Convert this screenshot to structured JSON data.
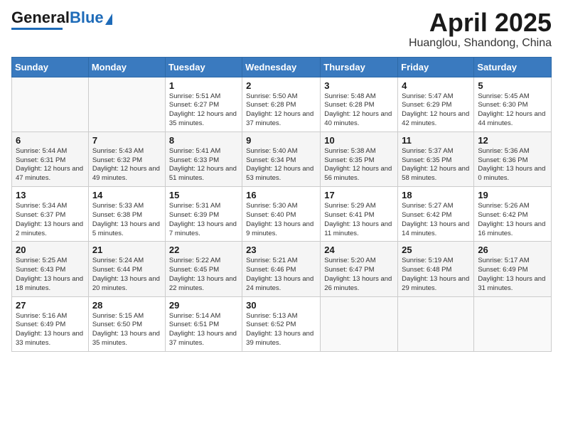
{
  "header": {
    "logo_general": "General",
    "logo_blue": "Blue",
    "title": "April 2025",
    "subtitle": "Huanglou, Shandong, China"
  },
  "weekdays": [
    "Sunday",
    "Monday",
    "Tuesday",
    "Wednesday",
    "Thursday",
    "Friday",
    "Saturday"
  ],
  "weeks": [
    [
      null,
      null,
      {
        "day": 1,
        "sunrise": "5:51 AM",
        "sunset": "6:27 PM",
        "daylight": "12 hours and 35 minutes."
      },
      {
        "day": 2,
        "sunrise": "5:50 AM",
        "sunset": "6:28 PM",
        "daylight": "12 hours and 37 minutes."
      },
      {
        "day": 3,
        "sunrise": "5:48 AM",
        "sunset": "6:28 PM",
        "daylight": "12 hours and 40 minutes."
      },
      {
        "day": 4,
        "sunrise": "5:47 AM",
        "sunset": "6:29 PM",
        "daylight": "12 hours and 42 minutes."
      },
      {
        "day": 5,
        "sunrise": "5:45 AM",
        "sunset": "6:30 PM",
        "daylight": "12 hours and 44 minutes."
      }
    ],
    [
      {
        "day": 6,
        "sunrise": "5:44 AM",
        "sunset": "6:31 PM",
        "daylight": "12 hours and 47 minutes."
      },
      {
        "day": 7,
        "sunrise": "5:43 AM",
        "sunset": "6:32 PM",
        "daylight": "12 hours and 49 minutes."
      },
      {
        "day": 8,
        "sunrise": "5:41 AM",
        "sunset": "6:33 PM",
        "daylight": "12 hours and 51 minutes."
      },
      {
        "day": 9,
        "sunrise": "5:40 AM",
        "sunset": "6:34 PM",
        "daylight": "12 hours and 53 minutes."
      },
      {
        "day": 10,
        "sunrise": "5:38 AM",
        "sunset": "6:35 PM",
        "daylight": "12 hours and 56 minutes."
      },
      {
        "day": 11,
        "sunrise": "5:37 AM",
        "sunset": "6:35 PM",
        "daylight": "12 hours and 58 minutes."
      },
      {
        "day": 12,
        "sunrise": "5:36 AM",
        "sunset": "6:36 PM",
        "daylight": "13 hours and 0 minutes."
      }
    ],
    [
      {
        "day": 13,
        "sunrise": "5:34 AM",
        "sunset": "6:37 PM",
        "daylight": "13 hours and 2 minutes."
      },
      {
        "day": 14,
        "sunrise": "5:33 AM",
        "sunset": "6:38 PM",
        "daylight": "13 hours and 5 minutes."
      },
      {
        "day": 15,
        "sunrise": "5:31 AM",
        "sunset": "6:39 PM",
        "daylight": "13 hours and 7 minutes."
      },
      {
        "day": 16,
        "sunrise": "5:30 AM",
        "sunset": "6:40 PM",
        "daylight": "13 hours and 9 minutes."
      },
      {
        "day": 17,
        "sunrise": "5:29 AM",
        "sunset": "6:41 PM",
        "daylight": "13 hours and 11 minutes."
      },
      {
        "day": 18,
        "sunrise": "5:27 AM",
        "sunset": "6:42 PM",
        "daylight": "13 hours and 14 minutes."
      },
      {
        "day": 19,
        "sunrise": "5:26 AM",
        "sunset": "6:42 PM",
        "daylight": "13 hours and 16 minutes."
      }
    ],
    [
      {
        "day": 20,
        "sunrise": "5:25 AM",
        "sunset": "6:43 PM",
        "daylight": "13 hours and 18 minutes."
      },
      {
        "day": 21,
        "sunrise": "5:24 AM",
        "sunset": "6:44 PM",
        "daylight": "13 hours and 20 minutes."
      },
      {
        "day": 22,
        "sunrise": "5:22 AM",
        "sunset": "6:45 PM",
        "daylight": "13 hours and 22 minutes."
      },
      {
        "day": 23,
        "sunrise": "5:21 AM",
        "sunset": "6:46 PM",
        "daylight": "13 hours and 24 minutes."
      },
      {
        "day": 24,
        "sunrise": "5:20 AM",
        "sunset": "6:47 PM",
        "daylight": "13 hours and 26 minutes."
      },
      {
        "day": 25,
        "sunrise": "5:19 AM",
        "sunset": "6:48 PM",
        "daylight": "13 hours and 29 minutes."
      },
      {
        "day": 26,
        "sunrise": "5:17 AM",
        "sunset": "6:49 PM",
        "daylight": "13 hours and 31 minutes."
      }
    ],
    [
      {
        "day": 27,
        "sunrise": "5:16 AM",
        "sunset": "6:49 PM",
        "daylight": "13 hours and 33 minutes."
      },
      {
        "day": 28,
        "sunrise": "5:15 AM",
        "sunset": "6:50 PM",
        "daylight": "13 hours and 35 minutes."
      },
      {
        "day": 29,
        "sunrise": "5:14 AM",
        "sunset": "6:51 PM",
        "daylight": "13 hours and 37 minutes."
      },
      {
        "day": 30,
        "sunrise": "5:13 AM",
        "sunset": "6:52 PM",
        "daylight": "13 hours and 39 minutes."
      },
      null,
      null,
      null
    ]
  ],
  "labels": {
    "sunrise": "Sunrise:",
    "sunset": "Sunset:",
    "daylight": "Daylight:"
  }
}
